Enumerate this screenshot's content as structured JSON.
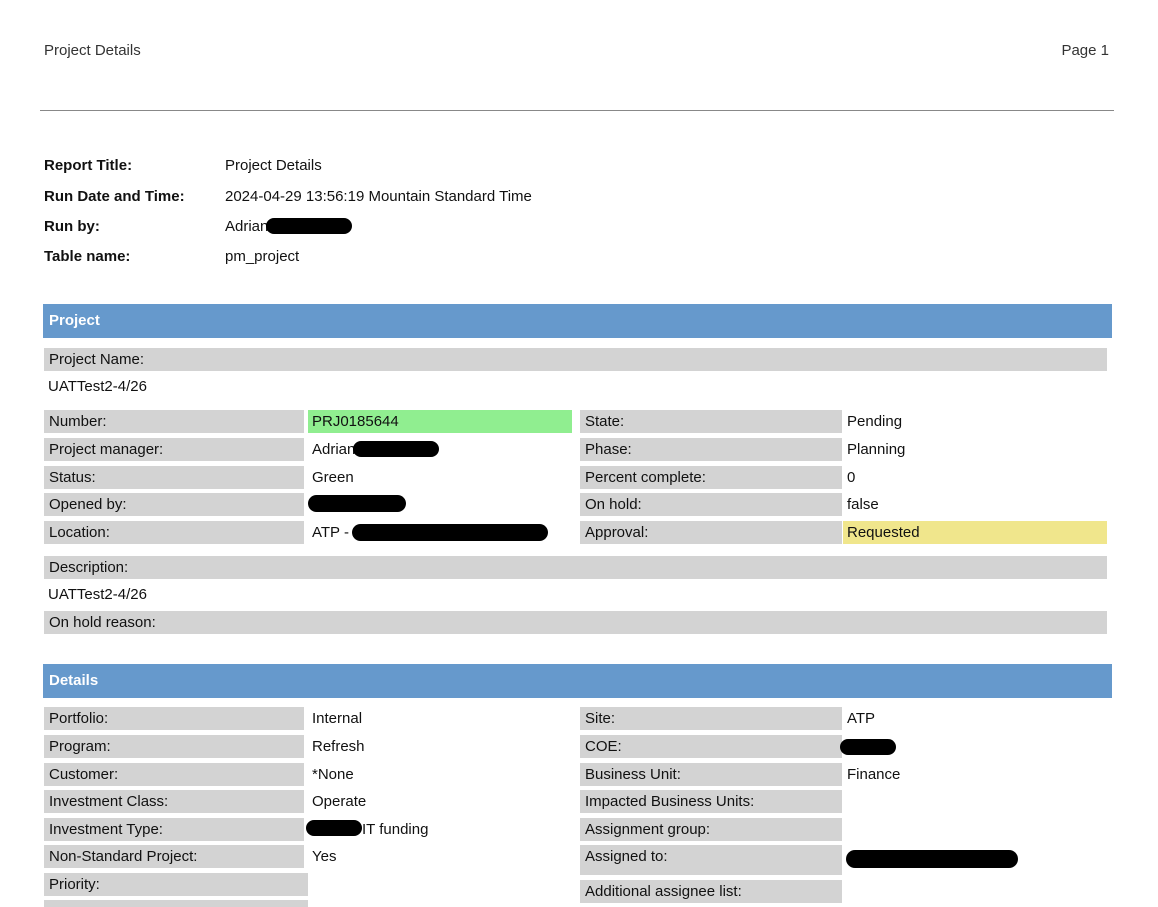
{
  "header": {
    "title": "Project Details",
    "page": "Page 1"
  },
  "report": {
    "title_label": "Report Title:",
    "title_value": "Project Details",
    "run_label": "Run Date and Time:",
    "run_value": "2024-04-29 13:56:19 Mountain Standard Time",
    "runby_label": "Run by:",
    "runby_value": "Adrian",
    "table_label": "Table name:",
    "table_value": "pm_project"
  },
  "project": {
    "section": "Project",
    "name_label": "Project Name:",
    "name_value": "UATTest2-4/26",
    "number_label": "Number:",
    "number_value": "PRJ0185644",
    "pm_label": "Project manager:",
    "pm_value": "Adrian",
    "status_label": "Status:",
    "status_value": "Green",
    "opened_label": "Opened by:",
    "opened_value": "",
    "location_label": "Location:",
    "location_value": "ATP -",
    "state_label": "State:",
    "state_value": "Pending",
    "phase_label": "Phase:",
    "phase_value": "Planning",
    "percent_label": "Percent complete:",
    "percent_value": "0",
    "onhold_label": "On hold:",
    "onhold_value": "false",
    "approval_label": "Approval:",
    "approval_value": "Requested",
    "desc_label": "Description:",
    "desc_value": "UATTest2-4/26",
    "onhold_reason_label": "On hold reason:"
  },
  "details": {
    "section": "Details",
    "portfolio_label": "Portfolio:",
    "portfolio_value": "Internal",
    "program_label": "Program:",
    "program_value": "Refresh",
    "customer_label": "Customer:",
    "customer_value": "*None",
    "inv_class_label": "Investment Class:",
    "inv_class_value": "Operate",
    "inv_type_label": "Investment Type:",
    "inv_type_value": "IT funding",
    "nonstd_label": "Non-Standard Project:",
    "nonstd_value": "Yes",
    "priority_label": "Priority:",
    "site_label": "Site:",
    "site_value": "ATP",
    "coe_label": "COE:",
    "bu_label": "Business Unit:",
    "bu_value": "Finance",
    "impacted_label": "Impacted Business Units:",
    "assign_group_label": "Assignment group:",
    "assigned_to_label": "Assigned to:",
    "additional_label": "Additional assignee list:"
  }
}
